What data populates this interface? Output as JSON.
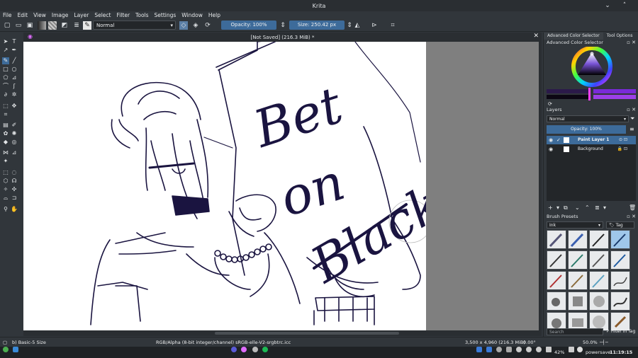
{
  "window": {
    "title": "Krita"
  },
  "menu": [
    "File",
    "Edit",
    "View",
    "Image",
    "Layer",
    "Select",
    "Filter",
    "Tools",
    "Settings",
    "Window",
    "Help"
  ],
  "toolbar": {
    "blend_mode": "Normal",
    "opacity_label": "Opacity: 100%",
    "size_label": "Size: 250.42 px"
  },
  "document": {
    "tab_title": "[Not Saved]  (216.3 MiB) *"
  },
  "canvas_text": [
    "Bet",
    "on",
    "Black!"
  ],
  "dock": {
    "tabs": [
      "Advanced Color Selector",
      "Tool Options"
    ],
    "color_selector_title": "Advanced Color Selector",
    "layers_title": "Layers",
    "layers_blend": "Normal",
    "layers_opacity": "Opacity: 100%",
    "layers": [
      {
        "name": "Paint Layer 1",
        "selected": true
      },
      {
        "name": "Background",
        "selected": false
      }
    ],
    "brush_presets_title": "Brush Presets",
    "brush_filter": "Ink",
    "brush_tag": "Tag",
    "search_placeholder": "Search",
    "filter_in_tag": "Filter in Tag"
  },
  "status": {
    "brush": "b) Basic-5 Size",
    "color_space": "RGB/Alpha (8-bit integer/channel)  sRGB-elle-V2-srgbtrc.icc",
    "dimensions": "3,500 x 4,960 (216.3 MiB)",
    "rotation": "0.00°",
    "zoom": "50.0%"
  },
  "taskbar": {
    "battery": "42%",
    "power_mode": "powersave",
    "clock": "11:19:15 pm"
  },
  "colors": {
    "accent": "#3d6b9a",
    "background": "#31363b",
    "ink": "#1a1440"
  }
}
